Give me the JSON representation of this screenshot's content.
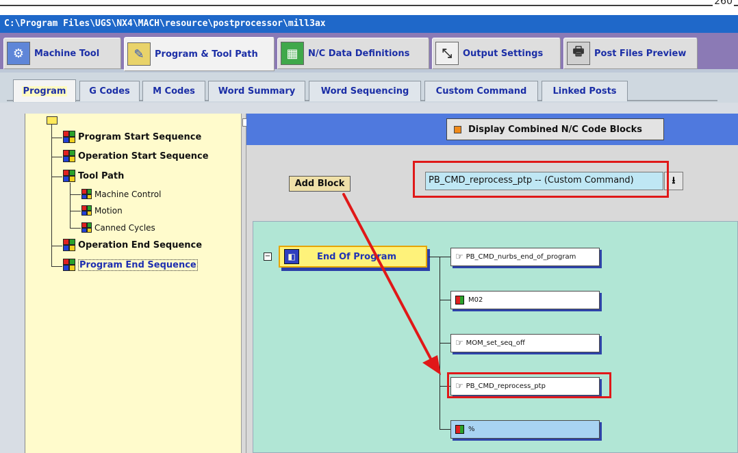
{
  "page_number": "260",
  "path": "C:\\Program Files\\UGS\\NX4\\MACH\\resource\\postprocessor\\mill3ax",
  "main_tabs": [
    {
      "label": "Machine Tool",
      "icon": "machine-tool-icon"
    },
    {
      "label": "Program & Tool Path",
      "icon": "program-toolpath-icon"
    },
    {
      "label": "N/C Data Definitions",
      "icon": "nc-data-icon"
    },
    {
      "label": "Output Settings",
      "icon": "output-settings-icon"
    },
    {
      "label": "Post Files Preview",
      "icon": "post-files-preview-icon"
    }
  ],
  "sub_tabs": [
    {
      "label": "Program"
    },
    {
      "label": "G Codes"
    },
    {
      "label": "M Codes"
    },
    {
      "label": "Word Summary"
    },
    {
      "label": "Word Sequencing"
    },
    {
      "label": "Custom Command"
    },
    {
      "label": "Linked Posts"
    }
  ],
  "tree": {
    "items": [
      {
        "label": "Program Start Sequence"
      },
      {
        "label": "Operation Start Sequence"
      },
      {
        "label": "Tool Path"
      },
      {
        "label": "Machine Control"
      },
      {
        "label": "Motion"
      },
      {
        "label": "Canned Cycles"
      },
      {
        "label": "Operation End Sequence"
      },
      {
        "label": "Program End Sequence"
      }
    ]
  },
  "toolbar": {
    "display_combined_label": "Display Combined N/C Code Blocks",
    "add_block_label": "Add Block",
    "command_select_value": "PB_CMD_reprocess_ptp -- (Custom Command)",
    "dropdown_glyph": "⭳"
  },
  "canvas": {
    "event_label": "End Of Program",
    "blocks": [
      {
        "label": "PB_CMD_nurbs_end_of_program",
        "type": "custom-command"
      },
      {
        "label": "M02",
        "type": "block"
      },
      {
        "label": "MOM_set_seq_off",
        "type": "custom-command"
      },
      {
        "label": "PB_CMD_reprocess_ptp",
        "type": "custom-command"
      },
      {
        "label": "%",
        "type": "block"
      }
    ]
  },
  "colors": {
    "annotation_red": "#e01818",
    "tree_background": "#fffbcc",
    "canvas_background": "#b1e6d5",
    "header_blue": "#4f79de"
  }
}
